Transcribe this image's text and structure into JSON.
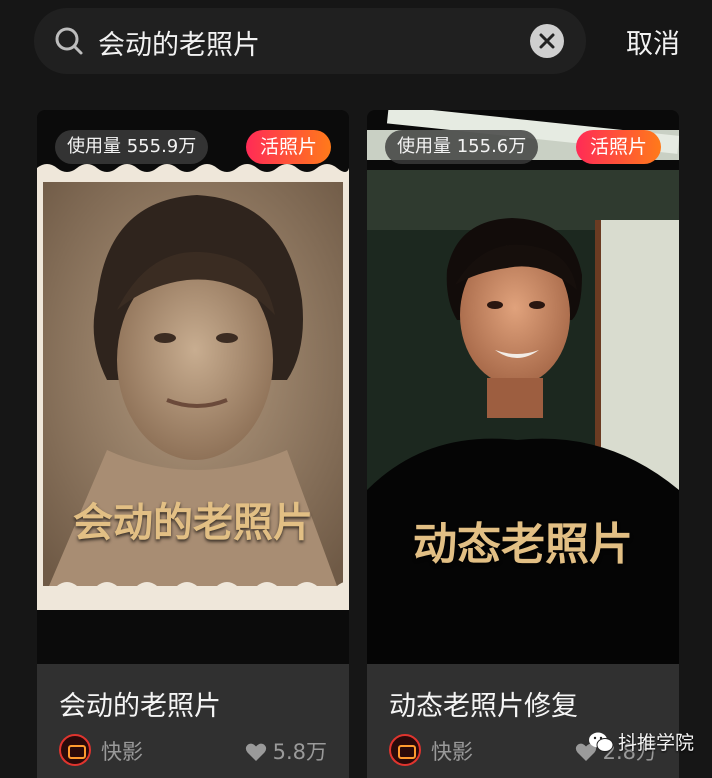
{
  "search": {
    "query": "会动的老照片",
    "cancel_label": "取消"
  },
  "cards": [
    {
      "usage": "使用量 555.9万",
      "badge": "活照片",
      "overlay_text": "会动的老照片",
      "title": "会动的老照片",
      "author": "快影",
      "likes": "5.8万"
    },
    {
      "usage": "使用量 155.6万",
      "badge": "活照片",
      "overlay_text": "动态老照片",
      "title": "动态老照片修复",
      "author": "快影",
      "likes": "2.8万"
    }
  ],
  "watermark": "抖推学院",
  "colors": {
    "background": "#161616",
    "card": "#303030",
    "badge_gradient_start": "#ff2b56",
    "badge_gradient_end": "#ff7a1a",
    "overlay_text": "#e2bf84"
  }
}
